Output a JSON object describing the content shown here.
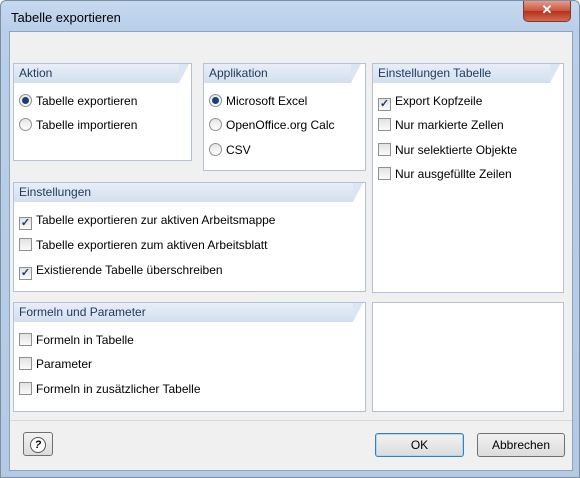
{
  "window": {
    "title": "Tabelle exportieren",
    "close_glyph": "✕"
  },
  "aktion": {
    "title": "Aktion",
    "options": [
      {
        "label": "Tabelle exportieren",
        "selected": true
      },
      {
        "label": "Tabelle importieren",
        "selected": false
      }
    ]
  },
  "applikation": {
    "title": "Applikation",
    "options": [
      {
        "label": "Microsoft Excel",
        "selected": true
      },
      {
        "label": "OpenOffice.org Calc",
        "selected": false
      },
      {
        "label": "CSV",
        "selected": false
      }
    ]
  },
  "einstellungen_tabelle": {
    "title": "Einstellungen Tabelle",
    "options": [
      {
        "label": "Export Kopfzeile",
        "checked": true
      },
      {
        "label": "Nur markierte Zellen",
        "checked": false
      },
      {
        "label": "Nur selektierte Objekte",
        "checked": false
      },
      {
        "label": "Nur ausgefüllte Zeilen",
        "checked": false
      }
    ]
  },
  "einstellungen": {
    "title": "Einstellungen",
    "options": [
      {
        "label": "Tabelle exportieren zur aktiven Arbeitsmappe",
        "checked": true
      },
      {
        "label": "Tabelle exportieren zum aktiven Arbeitsblatt",
        "checked": false
      },
      {
        "label": "Existierende Tabelle überschreiben",
        "checked": true
      }
    ]
  },
  "formeln": {
    "title": "Formeln und Parameter",
    "options": [
      {
        "label": "Formeln in Tabelle",
        "checked": false
      },
      {
        "label": "Parameter",
        "checked": false
      },
      {
        "label": "Formeln in zusätzlicher Tabelle",
        "checked": false
      }
    ]
  },
  "footer": {
    "help_glyph": "?",
    "ok_label": "OK",
    "cancel_label": "Abbrechen"
  }
}
